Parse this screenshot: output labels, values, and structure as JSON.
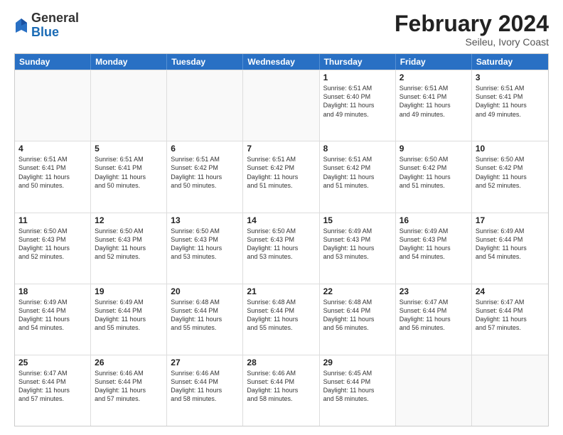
{
  "logo": {
    "general": "General",
    "blue": "Blue"
  },
  "header": {
    "month": "February 2024",
    "location": "Seileu, Ivory Coast"
  },
  "weekdays": [
    "Sunday",
    "Monday",
    "Tuesday",
    "Wednesday",
    "Thursday",
    "Friday",
    "Saturday"
  ],
  "rows": [
    [
      {
        "day": "",
        "detail": ""
      },
      {
        "day": "",
        "detail": ""
      },
      {
        "day": "",
        "detail": ""
      },
      {
        "day": "",
        "detail": ""
      },
      {
        "day": "1",
        "detail": "Sunrise: 6:51 AM\nSunset: 6:40 PM\nDaylight: 11 hours\nand 49 minutes."
      },
      {
        "day": "2",
        "detail": "Sunrise: 6:51 AM\nSunset: 6:41 PM\nDaylight: 11 hours\nand 49 minutes."
      },
      {
        "day": "3",
        "detail": "Sunrise: 6:51 AM\nSunset: 6:41 PM\nDaylight: 11 hours\nand 49 minutes."
      }
    ],
    [
      {
        "day": "4",
        "detail": "Sunrise: 6:51 AM\nSunset: 6:41 PM\nDaylight: 11 hours\nand 50 minutes."
      },
      {
        "day": "5",
        "detail": "Sunrise: 6:51 AM\nSunset: 6:41 PM\nDaylight: 11 hours\nand 50 minutes."
      },
      {
        "day": "6",
        "detail": "Sunrise: 6:51 AM\nSunset: 6:42 PM\nDaylight: 11 hours\nand 50 minutes."
      },
      {
        "day": "7",
        "detail": "Sunrise: 6:51 AM\nSunset: 6:42 PM\nDaylight: 11 hours\nand 51 minutes."
      },
      {
        "day": "8",
        "detail": "Sunrise: 6:51 AM\nSunset: 6:42 PM\nDaylight: 11 hours\nand 51 minutes."
      },
      {
        "day": "9",
        "detail": "Sunrise: 6:50 AM\nSunset: 6:42 PM\nDaylight: 11 hours\nand 51 minutes."
      },
      {
        "day": "10",
        "detail": "Sunrise: 6:50 AM\nSunset: 6:42 PM\nDaylight: 11 hours\nand 52 minutes."
      }
    ],
    [
      {
        "day": "11",
        "detail": "Sunrise: 6:50 AM\nSunset: 6:43 PM\nDaylight: 11 hours\nand 52 minutes."
      },
      {
        "day": "12",
        "detail": "Sunrise: 6:50 AM\nSunset: 6:43 PM\nDaylight: 11 hours\nand 52 minutes."
      },
      {
        "day": "13",
        "detail": "Sunrise: 6:50 AM\nSunset: 6:43 PM\nDaylight: 11 hours\nand 53 minutes."
      },
      {
        "day": "14",
        "detail": "Sunrise: 6:50 AM\nSunset: 6:43 PM\nDaylight: 11 hours\nand 53 minutes."
      },
      {
        "day": "15",
        "detail": "Sunrise: 6:49 AM\nSunset: 6:43 PM\nDaylight: 11 hours\nand 53 minutes."
      },
      {
        "day": "16",
        "detail": "Sunrise: 6:49 AM\nSunset: 6:43 PM\nDaylight: 11 hours\nand 54 minutes."
      },
      {
        "day": "17",
        "detail": "Sunrise: 6:49 AM\nSunset: 6:44 PM\nDaylight: 11 hours\nand 54 minutes."
      }
    ],
    [
      {
        "day": "18",
        "detail": "Sunrise: 6:49 AM\nSunset: 6:44 PM\nDaylight: 11 hours\nand 54 minutes."
      },
      {
        "day": "19",
        "detail": "Sunrise: 6:49 AM\nSunset: 6:44 PM\nDaylight: 11 hours\nand 55 minutes."
      },
      {
        "day": "20",
        "detail": "Sunrise: 6:48 AM\nSunset: 6:44 PM\nDaylight: 11 hours\nand 55 minutes."
      },
      {
        "day": "21",
        "detail": "Sunrise: 6:48 AM\nSunset: 6:44 PM\nDaylight: 11 hours\nand 55 minutes."
      },
      {
        "day": "22",
        "detail": "Sunrise: 6:48 AM\nSunset: 6:44 PM\nDaylight: 11 hours\nand 56 minutes."
      },
      {
        "day": "23",
        "detail": "Sunrise: 6:47 AM\nSunset: 6:44 PM\nDaylight: 11 hours\nand 56 minutes."
      },
      {
        "day": "24",
        "detail": "Sunrise: 6:47 AM\nSunset: 6:44 PM\nDaylight: 11 hours\nand 57 minutes."
      }
    ],
    [
      {
        "day": "25",
        "detail": "Sunrise: 6:47 AM\nSunset: 6:44 PM\nDaylight: 11 hours\nand 57 minutes."
      },
      {
        "day": "26",
        "detail": "Sunrise: 6:46 AM\nSunset: 6:44 PM\nDaylight: 11 hours\nand 57 minutes."
      },
      {
        "day": "27",
        "detail": "Sunrise: 6:46 AM\nSunset: 6:44 PM\nDaylight: 11 hours\nand 58 minutes."
      },
      {
        "day": "28",
        "detail": "Sunrise: 6:46 AM\nSunset: 6:44 PM\nDaylight: 11 hours\nand 58 minutes."
      },
      {
        "day": "29",
        "detail": "Sunrise: 6:45 AM\nSunset: 6:44 PM\nDaylight: 11 hours\nand 58 minutes."
      },
      {
        "day": "",
        "detail": ""
      },
      {
        "day": "",
        "detail": ""
      }
    ]
  ]
}
